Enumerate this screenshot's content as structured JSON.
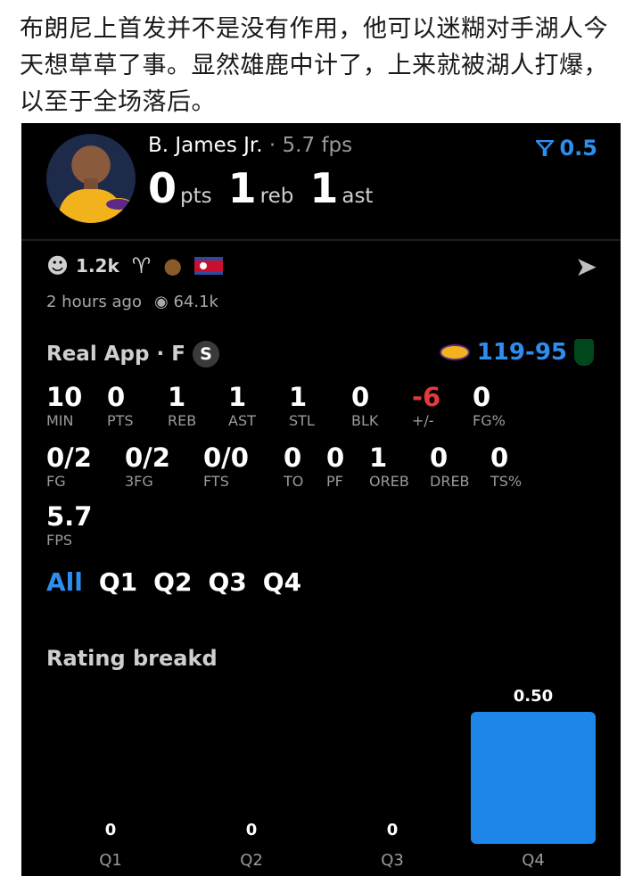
{
  "caption": "布朗尼上首发并不是没有作用，他可以迷糊对手湖人今天想草草了事。显然雄鹿中计了，上来就被湖人打爆，以至于全场落后。",
  "player": {
    "name": "B. James Jr.",
    "separator": "·",
    "fps": "5.7 fps",
    "pts": "0",
    "pts_unit": "pts",
    "reb": "1",
    "reb_unit": "reb",
    "ast": "1",
    "ast_unit": "ast"
  },
  "rating": {
    "icon": "filter-icon",
    "value": "0.5"
  },
  "reactions": {
    "smile_count": "1.2k",
    "icons": [
      "smile-icon",
      "goat-icon",
      "poop-icon",
      "flag-icon"
    ]
  },
  "meta": {
    "time": "2 hours ago",
    "views": "64.1k"
  },
  "game": {
    "source": "Real App",
    "separator": "·",
    "position": "F",
    "badge": "S",
    "home_score": "119",
    "dash": "-",
    "away_score": "95"
  },
  "stats_row1": [
    {
      "value": "10",
      "label": "MIN"
    },
    {
      "value": "0",
      "label": "PTS"
    },
    {
      "value": "1",
      "label": "REB"
    },
    {
      "value": "1",
      "label": "AST"
    },
    {
      "value": "1",
      "label": "STL"
    },
    {
      "value": "0",
      "label": "BLK"
    },
    {
      "value": "-6",
      "label": "+/-"
    },
    {
      "value": "0",
      "label": "FG%"
    }
  ],
  "stats_row2": [
    {
      "value": "0/2",
      "label": "FG"
    },
    {
      "value": "0/2",
      "label": "3FG"
    },
    {
      "value": "0/0",
      "label": "FTS"
    },
    {
      "value": "0",
      "label": "TO"
    },
    {
      "value": "0",
      "label": "PF"
    },
    {
      "value": "1",
      "label": "OREB"
    },
    {
      "value": "0",
      "label": "DREB"
    },
    {
      "value": "0",
      "label": "TS%"
    }
  ],
  "stats_row3": [
    {
      "value": "5.7",
      "label": "FPS"
    }
  ],
  "quarter_tabs": [
    "All",
    "Q1",
    "Q2",
    "Q3",
    "Q4"
  ],
  "rating_breakdown": {
    "title": "Rating breakd"
  },
  "chart_data": {
    "type": "bar",
    "categories": [
      "Q1",
      "Q2",
      "Q3",
      "Q4"
    ],
    "values": [
      0,
      0,
      0,
      0.5
    ],
    "value_labels": [
      "0",
      "0",
      "0",
      "0.50"
    ],
    "title": "",
    "xlabel": "",
    "ylabel": ""
  },
  "colors": {
    "accent": "#2e8ef0",
    "negative": "#e23b3b",
    "bar": "#1e86e8"
  }
}
